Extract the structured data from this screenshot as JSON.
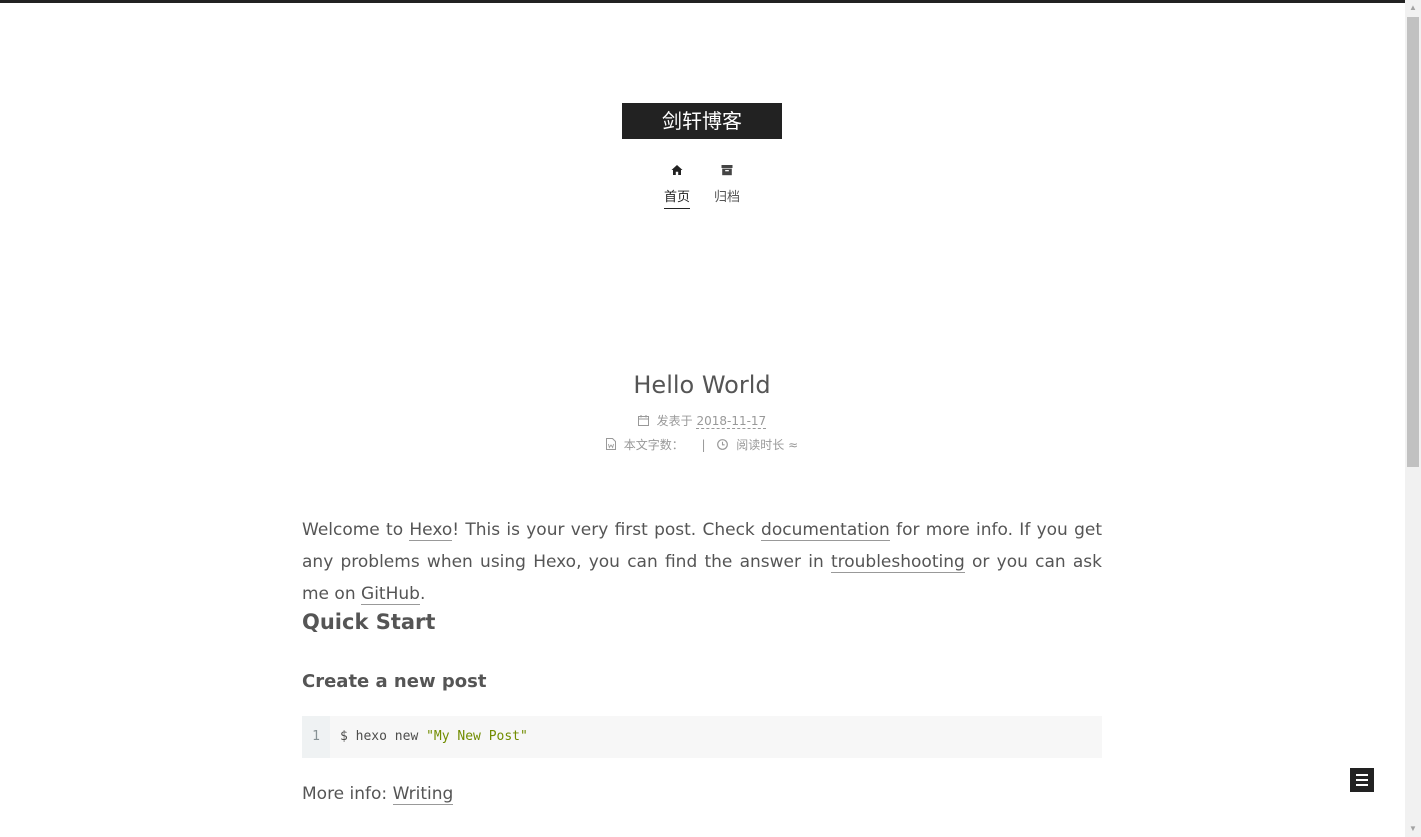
{
  "site": {
    "title": "剑轩博客"
  },
  "nav": {
    "items": [
      {
        "label": "首页",
        "icon": "home-icon",
        "active": true
      },
      {
        "label": "归档",
        "icon": "archive-icon",
        "active": false
      }
    ]
  },
  "post": {
    "title": "Hello World",
    "meta": {
      "posted_label": "发表于",
      "date": "2018-11-17",
      "wordcount_label": "本文字数：",
      "separator": "|",
      "reading_label": "阅读时长 ≈"
    },
    "intro": {
      "t1": "Welcome to ",
      "link_hexo": "Hexo",
      "t2": "! This is your very first post. Check ",
      "link_docs": "documentation",
      "t3": " for more info. If you get any problems when using Hexo, you can find the answer in ",
      "link_trouble": "troubleshooting",
      "t4": " or you can ask me on ",
      "link_github": "GitHub",
      "t5": "."
    },
    "section_heading": "Quick Start",
    "subsection_heading": "Create a new post",
    "code": {
      "line_number": "1",
      "command": "$ hexo new ",
      "argument": "\"My New Post\""
    },
    "more_info": {
      "label": "More info: ",
      "link": "Writing"
    }
  },
  "colors": {
    "accent": "#222222",
    "text": "#555555",
    "meta": "#999999",
    "code_string": "#718c00"
  }
}
